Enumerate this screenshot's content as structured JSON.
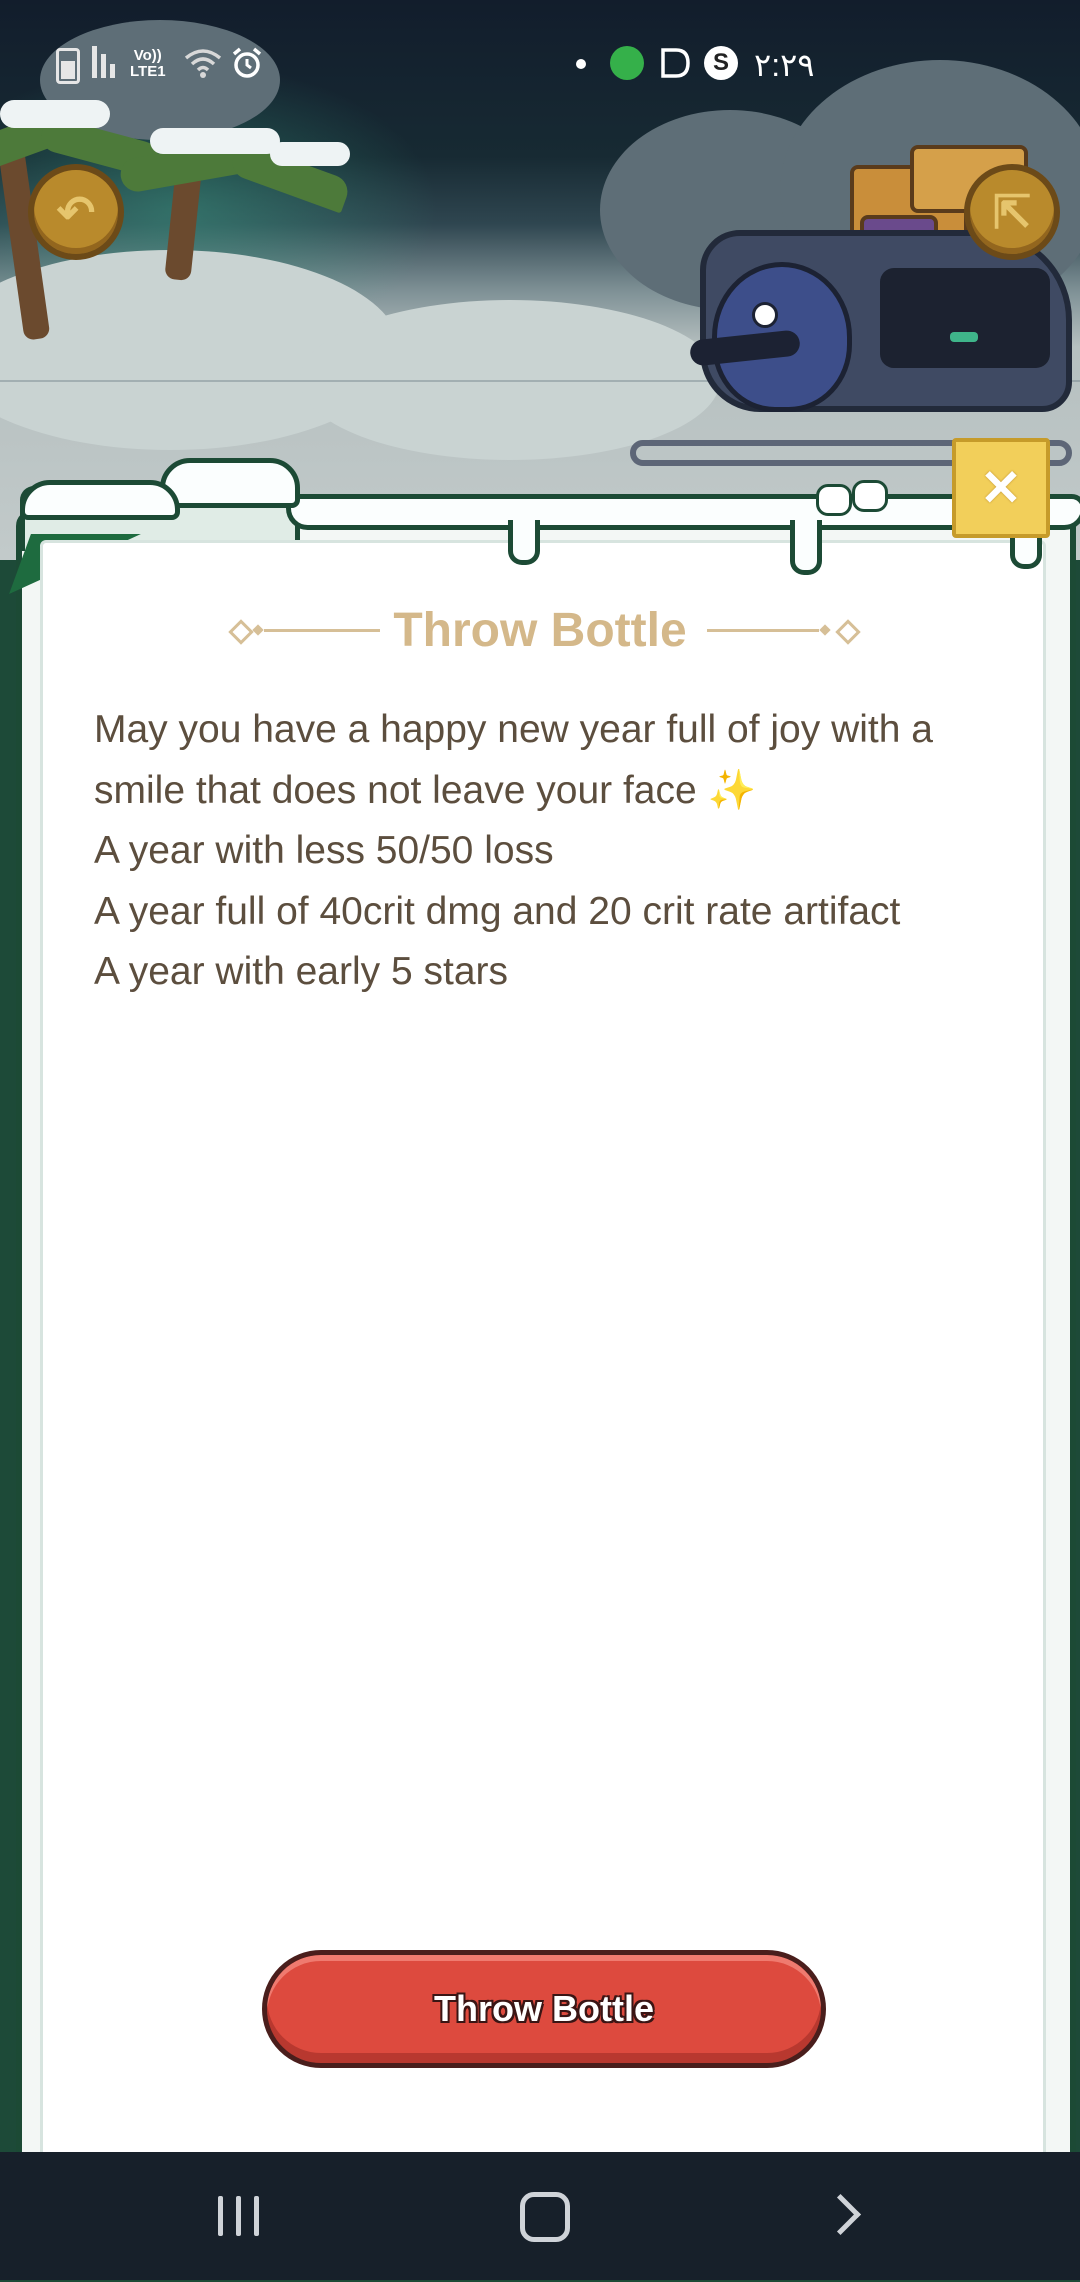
{
  "status_bar": {
    "network_label_top": "Vo))",
    "network_label_bottom": "LTE1",
    "time": "٢:٢٩"
  },
  "card": {
    "title": "Throw Bottle",
    "message_lines": [
      "May you have a happy new year full of joy with a",
      "smile that does not leave your face",
      "A year with less 50/50 loss",
      "A year full of 40crit dmg and 20 crit rate artifact",
      "A year with early 5 stars"
    ],
    "sparkle_emoji": "✨",
    "close_symbol": "✕",
    "throw_button_label": "Throw Bottle"
  },
  "icons": {
    "back": "back-arrow-icon",
    "share": "share-icon",
    "close": "close-icon"
  },
  "colors": {
    "frame_green": "#1c4a35",
    "title_gold": "#d4b88a",
    "text_brown": "#5c4e3e",
    "button_red": "#dd4a3e"
  }
}
